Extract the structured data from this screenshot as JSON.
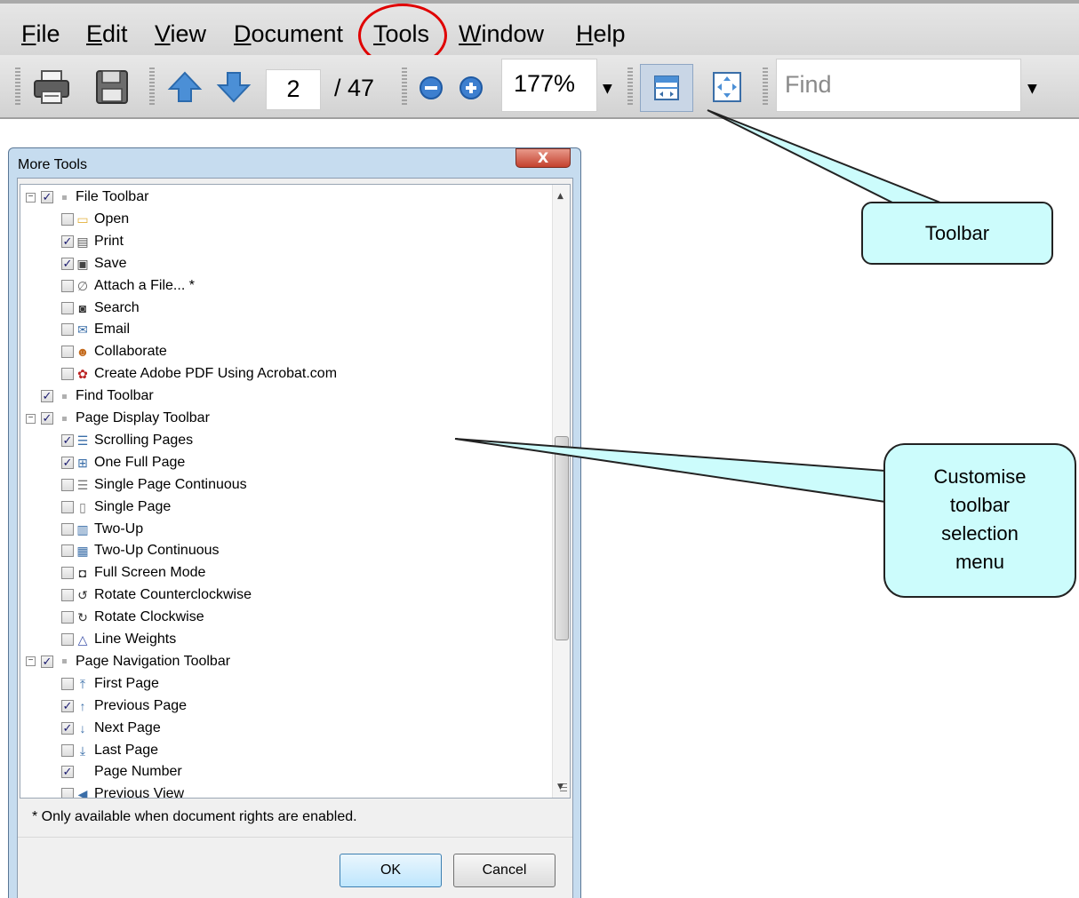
{
  "menubar": {
    "items": [
      {
        "label": "File",
        "mnemonic": "F",
        "rest": "ile"
      },
      {
        "label": "Edit",
        "mnemonic": "E",
        "rest": "dit"
      },
      {
        "label": "View",
        "mnemonic": "V",
        "rest": "iew"
      },
      {
        "label": "Document",
        "mnemonic": "D",
        "rest": "ocument"
      },
      {
        "label": "Tools",
        "mnemonic": "T",
        "rest": "ools"
      },
      {
        "label": "Window",
        "mnemonic": "W",
        "rest": "indow"
      },
      {
        "label": "Help",
        "mnemonic": "H",
        "rest": "elp"
      }
    ],
    "highlight_color": "#e00000"
  },
  "toolbar": {
    "page_number": "2",
    "page_total": "/ 47",
    "zoom": "177%",
    "find_placeholder": "Find",
    "icons": [
      "print-icon",
      "save-icon",
      "previous-page-icon",
      "next-page-icon",
      "zoom-out-icon",
      "zoom-in-icon",
      "scrolling-pages-icon",
      "one-full-page-icon"
    ]
  },
  "callouts": {
    "toolbar": "Toolbar",
    "customise": [
      "Customise",
      "toolbar",
      "selection",
      "menu"
    ],
    "fill_color": "#ccfcfc"
  },
  "dialog": {
    "title": "More Tools",
    "close_symbol": "X",
    "footnote": "* Only available when document rights are enabled.",
    "ok_label": "OK",
    "cancel_label": "Cancel",
    "tree": [
      {
        "level": 0,
        "label": "File Toolbar",
        "checked": true,
        "expander": "⊟",
        "icon": ""
      },
      {
        "level": 1,
        "label": "Open",
        "checked": false,
        "icon": "folder-icon"
      },
      {
        "level": 1,
        "label": "Print",
        "checked": true,
        "icon": "print-icon"
      },
      {
        "level": 1,
        "label": "Save",
        "checked": true,
        "icon": "save-icon"
      },
      {
        "level": 1,
        "label": "Attach a File... *",
        "checked": false,
        "icon": "paperclip-icon"
      },
      {
        "level": 1,
        "label": "Search",
        "checked": false,
        "icon": "binoculars-icon"
      },
      {
        "level": 1,
        "label": "Email",
        "checked": false,
        "icon": "email-icon"
      },
      {
        "level": 1,
        "label": "Collaborate",
        "checked": false,
        "icon": "collaborate-icon"
      },
      {
        "level": 1,
        "label": "Create Adobe PDF Using Acrobat.com",
        "checked": false,
        "icon": "create-pdf-icon"
      },
      {
        "level": 0,
        "label": "Find Toolbar",
        "checked": true,
        "expander": "",
        "icon": ""
      },
      {
        "level": 0,
        "label": "Page Display Toolbar",
        "checked": true,
        "expander": "⊟",
        "icon": ""
      },
      {
        "level": 1,
        "label": "Scrolling Pages",
        "checked": true,
        "icon": "scrolling-pages-icon"
      },
      {
        "level": 1,
        "label": "One Full Page",
        "checked": true,
        "icon": "one-full-page-icon"
      },
      {
        "level": 1,
        "label": "Single Page Continuous",
        "checked": false,
        "icon": "single-page-continuous-icon"
      },
      {
        "level": 1,
        "label": "Single Page",
        "checked": false,
        "icon": "single-page-icon"
      },
      {
        "level": 1,
        "label": "Two-Up",
        "checked": false,
        "icon": "two-up-icon"
      },
      {
        "level": 1,
        "label": "Two-Up Continuous",
        "checked": false,
        "icon": "two-up-continuous-icon"
      },
      {
        "level": 1,
        "label": "Full Screen Mode",
        "checked": false,
        "icon": "full-screen-icon"
      },
      {
        "level": 1,
        "label": "Rotate Counterclockwise",
        "checked": false,
        "icon": "rotate-counterclockwise-icon"
      },
      {
        "level": 1,
        "label": "Rotate Clockwise",
        "checked": false,
        "icon": "rotate-clockwise-icon"
      },
      {
        "level": 1,
        "label": "Line Weights",
        "checked": false,
        "icon": "line-weights-icon"
      },
      {
        "level": 0,
        "label": "Page Navigation Toolbar",
        "checked": true,
        "expander": "⊟",
        "icon": ""
      },
      {
        "level": 1,
        "label": "First Page",
        "checked": false,
        "icon": "first-page-icon"
      },
      {
        "level": 1,
        "label": "Previous Page",
        "checked": true,
        "icon": "previous-page-icon"
      },
      {
        "level": 1,
        "label": "Next Page",
        "checked": true,
        "icon": "next-page-icon"
      },
      {
        "level": 1,
        "label": "Last Page",
        "checked": false,
        "icon": "last-page-icon"
      },
      {
        "level": 1,
        "label": "Page Number",
        "checked": true,
        "icon": ""
      },
      {
        "level": 1,
        "label": "Previous View",
        "checked": false,
        "icon": "previous-view-icon"
      }
    ]
  }
}
